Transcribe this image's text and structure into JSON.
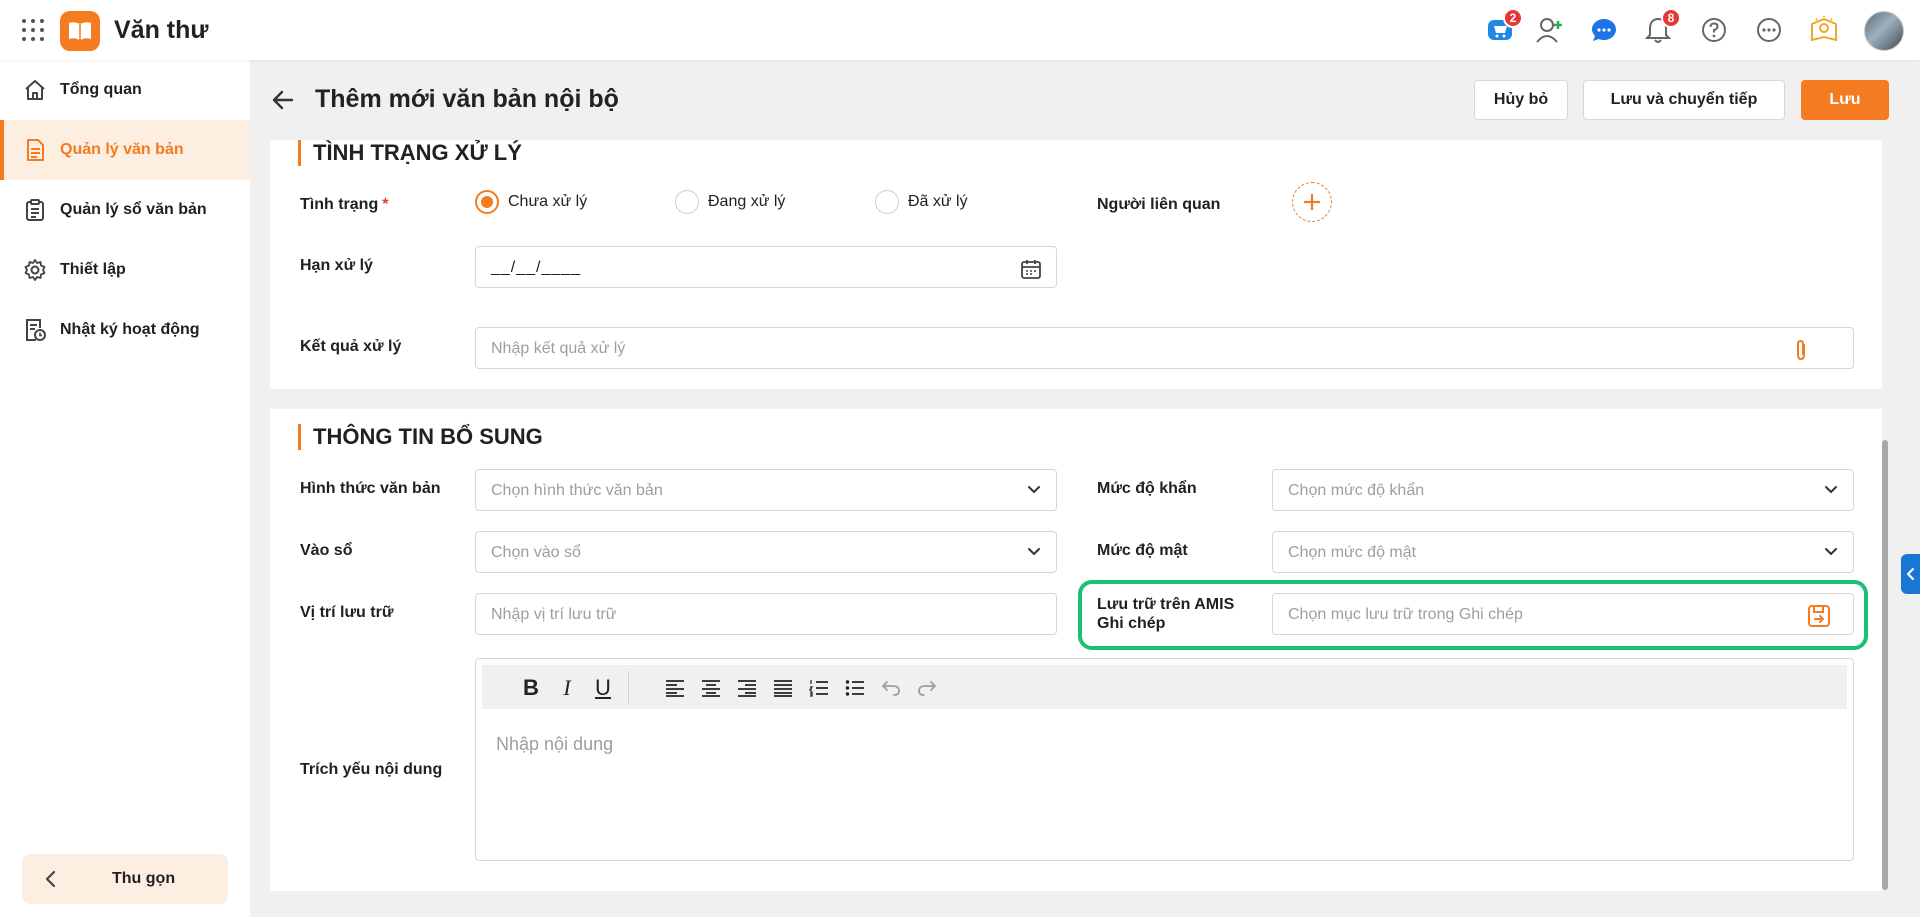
{
  "app": {
    "title": "Văn thư",
    "brand_color": "#f47b20",
    "icons": [
      "apps-grid-icon",
      "book-logo-icon"
    ]
  },
  "topbar": {
    "cart_badge": "2",
    "notification_badge": "8",
    "icons": [
      "shopping-cart-icon",
      "add-user-icon",
      "chat-icon",
      "bell-icon",
      "help-icon",
      "more-icon",
      "idea-icon",
      "avatar"
    ]
  },
  "sidebar": {
    "items": [
      {
        "label": "Tổng quan",
        "icon": "home-icon",
        "active": false
      },
      {
        "label": "Quản lý văn bản",
        "icon": "document-icon",
        "active": true
      },
      {
        "label": "Quản lý sổ văn bản",
        "icon": "clipboard-icon",
        "active": false
      },
      {
        "label": "Thiết lập",
        "icon": "gear-icon",
        "active": false
      },
      {
        "label": "Nhật ký hoạt động",
        "icon": "activity-log-icon",
        "active": false
      }
    ],
    "collapse_label": "Thu gọn"
  },
  "header": {
    "title": "Thêm mới văn bản nội bộ",
    "cancel_label": "Hủy bỏ",
    "save_forward_label": "Lưu và chuyển tiếp",
    "save_label": "Lưu"
  },
  "processing": {
    "section_title": "TÌNH TRẠNG XỬ LÝ",
    "status_label": "Tình trạng",
    "required_mark": "*",
    "status_options": [
      "Chưa xử lý",
      "Đang xử lý",
      "Đã xử lý"
    ],
    "status_selected": "Chưa xử lý",
    "related_people_label": "Người liên quan",
    "deadline_label": "Hạn xử lý",
    "deadline_value": "__/__/____",
    "result_label": "Kết quả xử lý",
    "result_placeholder": "Nhập kết quả xử lý"
  },
  "additional": {
    "section_title": "THÔNG TIN BỔ SUNG",
    "doc_form_label": "Hình thức văn bản",
    "doc_form_placeholder": "Chọn hình thức văn bản",
    "urgency_label": "Mức độ khẩn",
    "urgency_placeholder": "Chọn mức độ khẩn",
    "register_label": "Vào sổ",
    "register_placeholder": "Chọn vào sổ",
    "confidentiality_label": "Mức độ mật",
    "confidentiality_placeholder": "Chọn mức độ mật",
    "storage_location_label": "Vị trí lưu trữ",
    "storage_location_placeholder": "Nhập vị trí lưu trữ",
    "amis_storage_label_line1": "Lưu trữ trên AMIS",
    "amis_storage_label_line2": "Ghi chép",
    "amis_storage_placeholder": "Chọn mục lưu trữ trong Ghi chép",
    "summary_label": "Trích yếu nội dung",
    "summary_placeholder": "Nhập nội dung",
    "highlight_color": "#1dbf73"
  },
  "editor_toolbar": {
    "bold": "B",
    "italic": "I",
    "underline": "U",
    "icons": [
      "align-left-icon",
      "align-center-icon",
      "align-right-icon",
      "align-justify-icon",
      "ordered-list-icon",
      "bullet-list-icon",
      "undo-icon",
      "redo-icon"
    ]
  }
}
